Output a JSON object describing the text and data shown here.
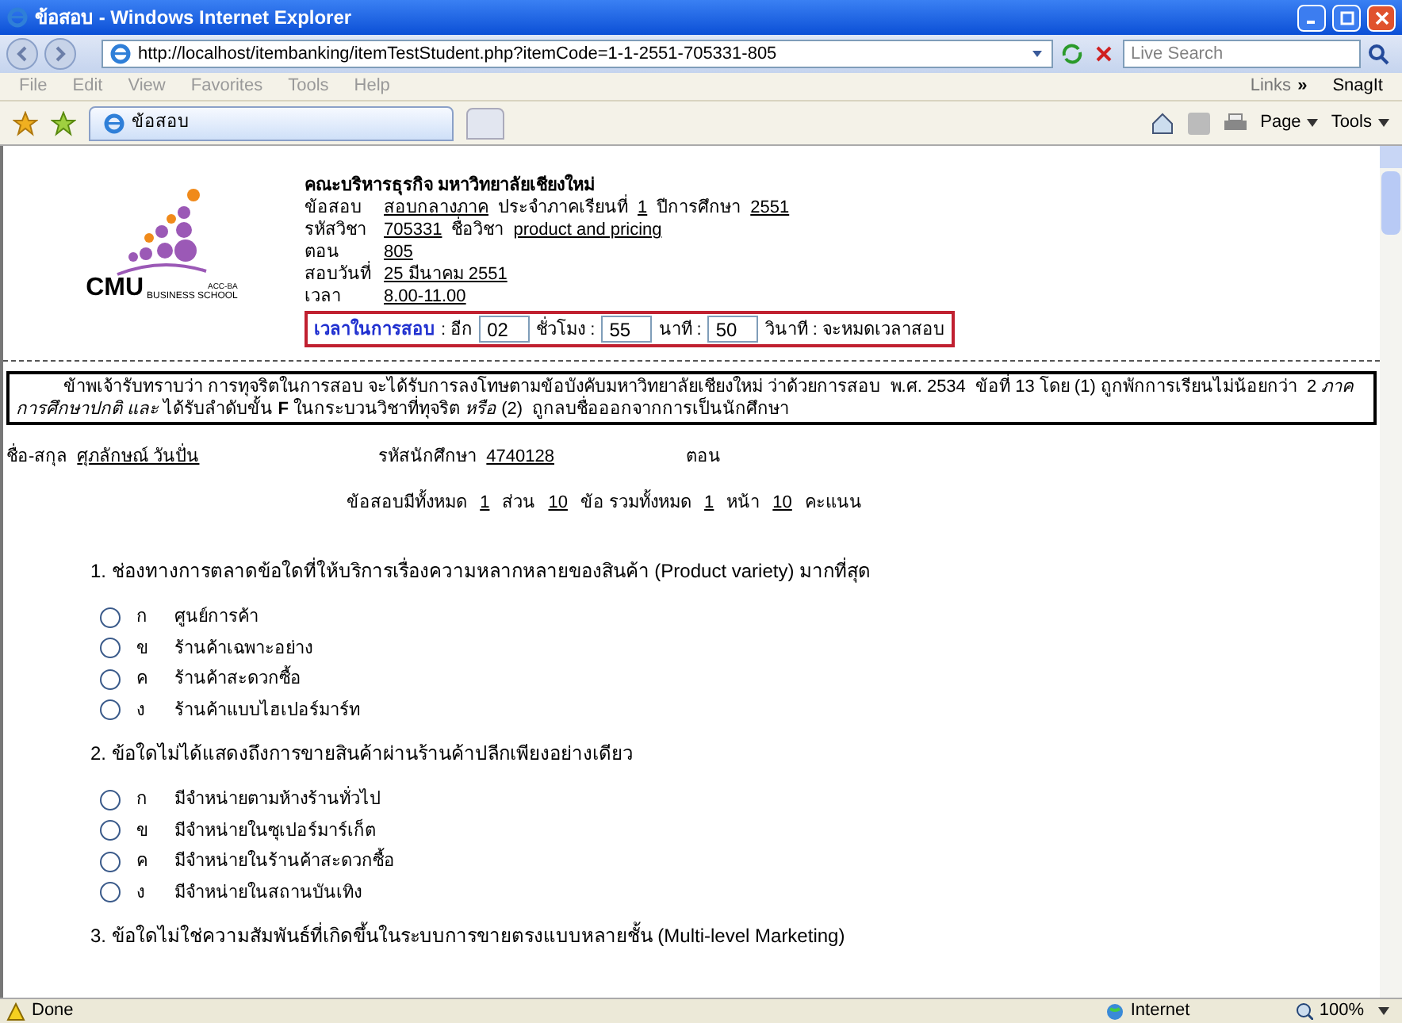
{
  "window": {
    "title": "ข้อสอบ - Windows Internet Explorer"
  },
  "address_bar": {
    "url": "http://localhost/itembanking/itemTestStudent.php?itemCode=1-1-2551-705331-805"
  },
  "search": {
    "placeholder": "Live Search"
  },
  "menu": [
    "File",
    "Edit",
    "View",
    "Favorites",
    "Tools",
    "Help"
  ],
  "links_toolbar": {
    "label": "Links",
    "chevron": "»",
    "snagit": "SnagIt"
  },
  "tabs": [
    {
      "label": "ข้อสอบ",
      "selected": true
    }
  ],
  "command_bar": [
    "Page",
    "Tools"
  ],
  "header": {
    "faculty": "คณะบริหารธุรกิจ มหาวิทยาลัยเชียงใหม่",
    "logo_text": "CMU",
    "logo_sub": "BUSINESS SCHOOL",
    "logo_tag": "ACC-BA",
    "rows": [
      {
        "segments": [
          {
            "text": "ข้อสอบ",
            "underline": false
          },
          {
            "text": "สอบกลางภาค",
            "underline": true
          },
          {
            "text": "ประจำภาคเรียนที่",
            "underline": false
          },
          {
            "text": "1",
            "underline": true
          },
          {
            "text": "ปีการศึกษา",
            "underline": false
          },
          {
            "text": "2551",
            "underline": true
          }
        ]
      },
      {
        "segments": [
          {
            "text": "รหัสวิชา",
            "underline": false
          },
          {
            "text": "705331",
            "underline": true
          },
          {
            "text": "ชื่อวิชา",
            "underline": false
          },
          {
            "text": "product and pricing",
            "underline": true
          }
        ]
      },
      {
        "segments": [
          {
            "text": "ตอน",
            "underline": false
          },
          {
            "text": "805",
            "underline": true
          }
        ]
      },
      {
        "segments": [
          {
            "text": "สอบวันที่",
            "underline": false
          },
          {
            "text": "25 มีนาคม  2551",
            "underline": true
          }
        ]
      },
      {
        "segments": [
          {
            "text": "เวลา",
            "underline": false
          },
          {
            "text": "8.00-11.00",
            "underline": true
          }
        ]
      }
    ],
    "timer": {
      "label": "เวลาในการสอบ",
      "parts": [
        {
          "kind": "text",
          "text": ": อีก"
        },
        {
          "kind": "field",
          "text": "02"
        },
        {
          "kind": "text",
          "text": "ชั่วโมง :"
        },
        {
          "kind": "field",
          "text": "55"
        },
        {
          "kind": "text",
          "text": "นาที :"
        },
        {
          "kind": "field",
          "text": "50"
        },
        {
          "kind": "text",
          "text": "วินาที : จะหมดเวลาสอบ"
        }
      ]
    }
  },
  "notice": "ข้าพเจ้ารับทราบว่า การทุจริตในการสอบ จะได้รับการลงโทษตามข้อบังคับมหาวิทยาลัยเชียงใหม่ ว่าด้วยการสอบ  พ.ศ. 2534  ข้อที่ 13 โดย (1) ถูกพักการเรียนไม่น้อยกว่า  2 *ภาคการศึกษาปกติ* *และ* ได้รับลำดับขั้น **F** ในกระบวนวิชาที่ทุจริต *หรือ* (2)  ถูกลบชื่อออกจากการเป็นนักศึกษา",
  "student": {
    "name_label": "ชื่อ-สกุล",
    "name": "ศุภลักษณ์ วันปั่น",
    "id_label": "รหัสนักศึกษา",
    "id": "4740128",
    "section_label": "ตอน"
  },
  "summary": [
    {
      "text": "ข้อสอบมีทั้งหมด",
      "underline": false
    },
    {
      "text": "1",
      "underline": true
    },
    {
      "text": "ส่วน",
      "underline": false
    },
    {
      "text": "10",
      "underline": true
    },
    {
      "text": "ข้อ  รวมทั้งหมด",
      "underline": false
    },
    {
      "text": "1",
      "underline": true
    },
    {
      "text": "หน้า",
      "underline": false
    },
    {
      "text": "10",
      "underline": true
    },
    {
      "text": "คะแนน",
      "underline": false
    }
  ],
  "questions": [
    {
      "text": "1. ช่องทางการตลาดข้อใดที่ให้บริการเรื่องความหลากหลายของสินค้า (Product variety) มากที่สุด",
      "options": [
        {
          "letter": "ก",
          "text": "ศูนย์การค้า",
          "selected": false
        },
        {
          "letter": "ข",
          "text": "ร้านค้าเฉพาะอย่าง",
          "selected": false
        },
        {
          "letter": "ค",
          "text": "ร้านค้าสะดวกซื้อ",
          "selected": false
        },
        {
          "letter": "ง",
          "text": "ร้านค้าแบบไฮเปอร์มาร์ท",
          "selected": false
        }
      ]
    },
    {
      "text": "2. ข้อใดไม่ได้แสดงถึงการขายสินค้าผ่านร้านค้าปลีกเพียงอย่างเดียว",
      "options": [
        {
          "letter": "ก",
          "text": "มีจำหน่ายตามห้างร้านทั่วไป",
          "selected": false
        },
        {
          "letter": "ข",
          "text": "มีจำหน่ายในซุเปอร์มาร์เก็ต",
          "selected": false
        },
        {
          "letter": "ค",
          "text": "มีจำหน่ายในร้านค้าสะดวกซื้อ",
          "selected": false
        },
        {
          "letter": "ง",
          "text": "มีจำหน่ายในสถานบันเทิง",
          "selected": false
        }
      ]
    },
    {
      "text": "3. ข้อใดไม่ใช่ความสัมพันธ์ที่เกิดขึ้นในระบบการขายตรงแบบหลายชั้น (Multi-level Marketing)"
    }
  ],
  "status_bar": {
    "text": "Done",
    "zone": "Internet",
    "zoom": "100%"
  }
}
